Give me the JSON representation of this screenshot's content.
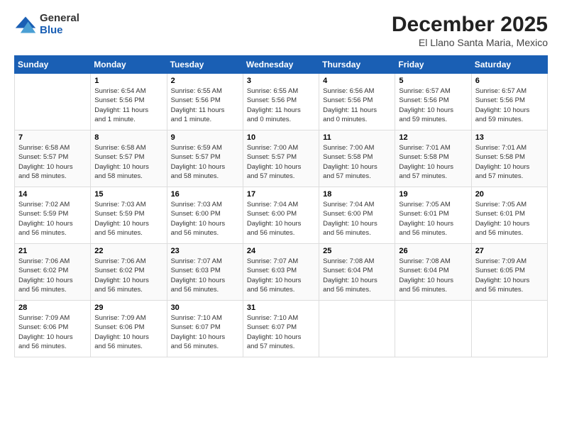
{
  "logo": {
    "general": "General",
    "blue": "Blue"
  },
  "title": "December 2025",
  "location": "El Llano Santa Maria, Mexico",
  "weekdays": [
    "Sunday",
    "Monday",
    "Tuesday",
    "Wednesday",
    "Thursday",
    "Friday",
    "Saturday"
  ],
  "weeks": [
    [
      {
        "day": "",
        "info": ""
      },
      {
        "day": "1",
        "info": "Sunrise: 6:54 AM\nSunset: 5:56 PM\nDaylight: 11 hours\nand 1 minute."
      },
      {
        "day": "2",
        "info": "Sunrise: 6:55 AM\nSunset: 5:56 PM\nDaylight: 11 hours\nand 1 minute."
      },
      {
        "day": "3",
        "info": "Sunrise: 6:55 AM\nSunset: 5:56 PM\nDaylight: 11 hours\nand 0 minutes."
      },
      {
        "day": "4",
        "info": "Sunrise: 6:56 AM\nSunset: 5:56 PM\nDaylight: 11 hours\nand 0 minutes."
      },
      {
        "day": "5",
        "info": "Sunrise: 6:57 AM\nSunset: 5:56 PM\nDaylight: 10 hours\nand 59 minutes."
      },
      {
        "day": "6",
        "info": "Sunrise: 6:57 AM\nSunset: 5:56 PM\nDaylight: 10 hours\nand 59 minutes."
      }
    ],
    [
      {
        "day": "7",
        "info": "Sunrise: 6:58 AM\nSunset: 5:57 PM\nDaylight: 10 hours\nand 58 minutes."
      },
      {
        "day": "8",
        "info": "Sunrise: 6:58 AM\nSunset: 5:57 PM\nDaylight: 10 hours\nand 58 minutes."
      },
      {
        "day": "9",
        "info": "Sunrise: 6:59 AM\nSunset: 5:57 PM\nDaylight: 10 hours\nand 58 minutes."
      },
      {
        "day": "10",
        "info": "Sunrise: 7:00 AM\nSunset: 5:57 PM\nDaylight: 10 hours\nand 57 minutes."
      },
      {
        "day": "11",
        "info": "Sunrise: 7:00 AM\nSunset: 5:58 PM\nDaylight: 10 hours\nand 57 minutes."
      },
      {
        "day": "12",
        "info": "Sunrise: 7:01 AM\nSunset: 5:58 PM\nDaylight: 10 hours\nand 57 minutes."
      },
      {
        "day": "13",
        "info": "Sunrise: 7:01 AM\nSunset: 5:58 PM\nDaylight: 10 hours\nand 57 minutes."
      }
    ],
    [
      {
        "day": "14",
        "info": "Sunrise: 7:02 AM\nSunset: 5:59 PM\nDaylight: 10 hours\nand 56 minutes."
      },
      {
        "day": "15",
        "info": "Sunrise: 7:03 AM\nSunset: 5:59 PM\nDaylight: 10 hours\nand 56 minutes."
      },
      {
        "day": "16",
        "info": "Sunrise: 7:03 AM\nSunset: 6:00 PM\nDaylight: 10 hours\nand 56 minutes."
      },
      {
        "day": "17",
        "info": "Sunrise: 7:04 AM\nSunset: 6:00 PM\nDaylight: 10 hours\nand 56 minutes."
      },
      {
        "day": "18",
        "info": "Sunrise: 7:04 AM\nSunset: 6:00 PM\nDaylight: 10 hours\nand 56 minutes."
      },
      {
        "day": "19",
        "info": "Sunrise: 7:05 AM\nSunset: 6:01 PM\nDaylight: 10 hours\nand 56 minutes."
      },
      {
        "day": "20",
        "info": "Sunrise: 7:05 AM\nSunset: 6:01 PM\nDaylight: 10 hours\nand 56 minutes."
      }
    ],
    [
      {
        "day": "21",
        "info": "Sunrise: 7:06 AM\nSunset: 6:02 PM\nDaylight: 10 hours\nand 56 minutes."
      },
      {
        "day": "22",
        "info": "Sunrise: 7:06 AM\nSunset: 6:02 PM\nDaylight: 10 hours\nand 56 minutes."
      },
      {
        "day": "23",
        "info": "Sunrise: 7:07 AM\nSunset: 6:03 PM\nDaylight: 10 hours\nand 56 minutes."
      },
      {
        "day": "24",
        "info": "Sunrise: 7:07 AM\nSunset: 6:03 PM\nDaylight: 10 hours\nand 56 minutes."
      },
      {
        "day": "25",
        "info": "Sunrise: 7:08 AM\nSunset: 6:04 PM\nDaylight: 10 hours\nand 56 minutes."
      },
      {
        "day": "26",
        "info": "Sunrise: 7:08 AM\nSunset: 6:04 PM\nDaylight: 10 hours\nand 56 minutes."
      },
      {
        "day": "27",
        "info": "Sunrise: 7:09 AM\nSunset: 6:05 PM\nDaylight: 10 hours\nand 56 minutes."
      }
    ],
    [
      {
        "day": "28",
        "info": "Sunrise: 7:09 AM\nSunset: 6:06 PM\nDaylight: 10 hours\nand 56 minutes."
      },
      {
        "day": "29",
        "info": "Sunrise: 7:09 AM\nSunset: 6:06 PM\nDaylight: 10 hours\nand 56 minutes."
      },
      {
        "day": "30",
        "info": "Sunrise: 7:10 AM\nSunset: 6:07 PM\nDaylight: 10 hours\nand 56 minutes."
      },
      {
        "day": "31",
        "info": "Sunrise: 7:10 AM\nSunset: 6:07 PM\nDaylight: 10 hours\nand 57 minutes."
      },
      {
        "day": "",
        "info": ""
      },
      {
        "day": "",
        "info": ""
      },
      {
        "day": "",
        "info": ""
      }
    ]
  ]
}
